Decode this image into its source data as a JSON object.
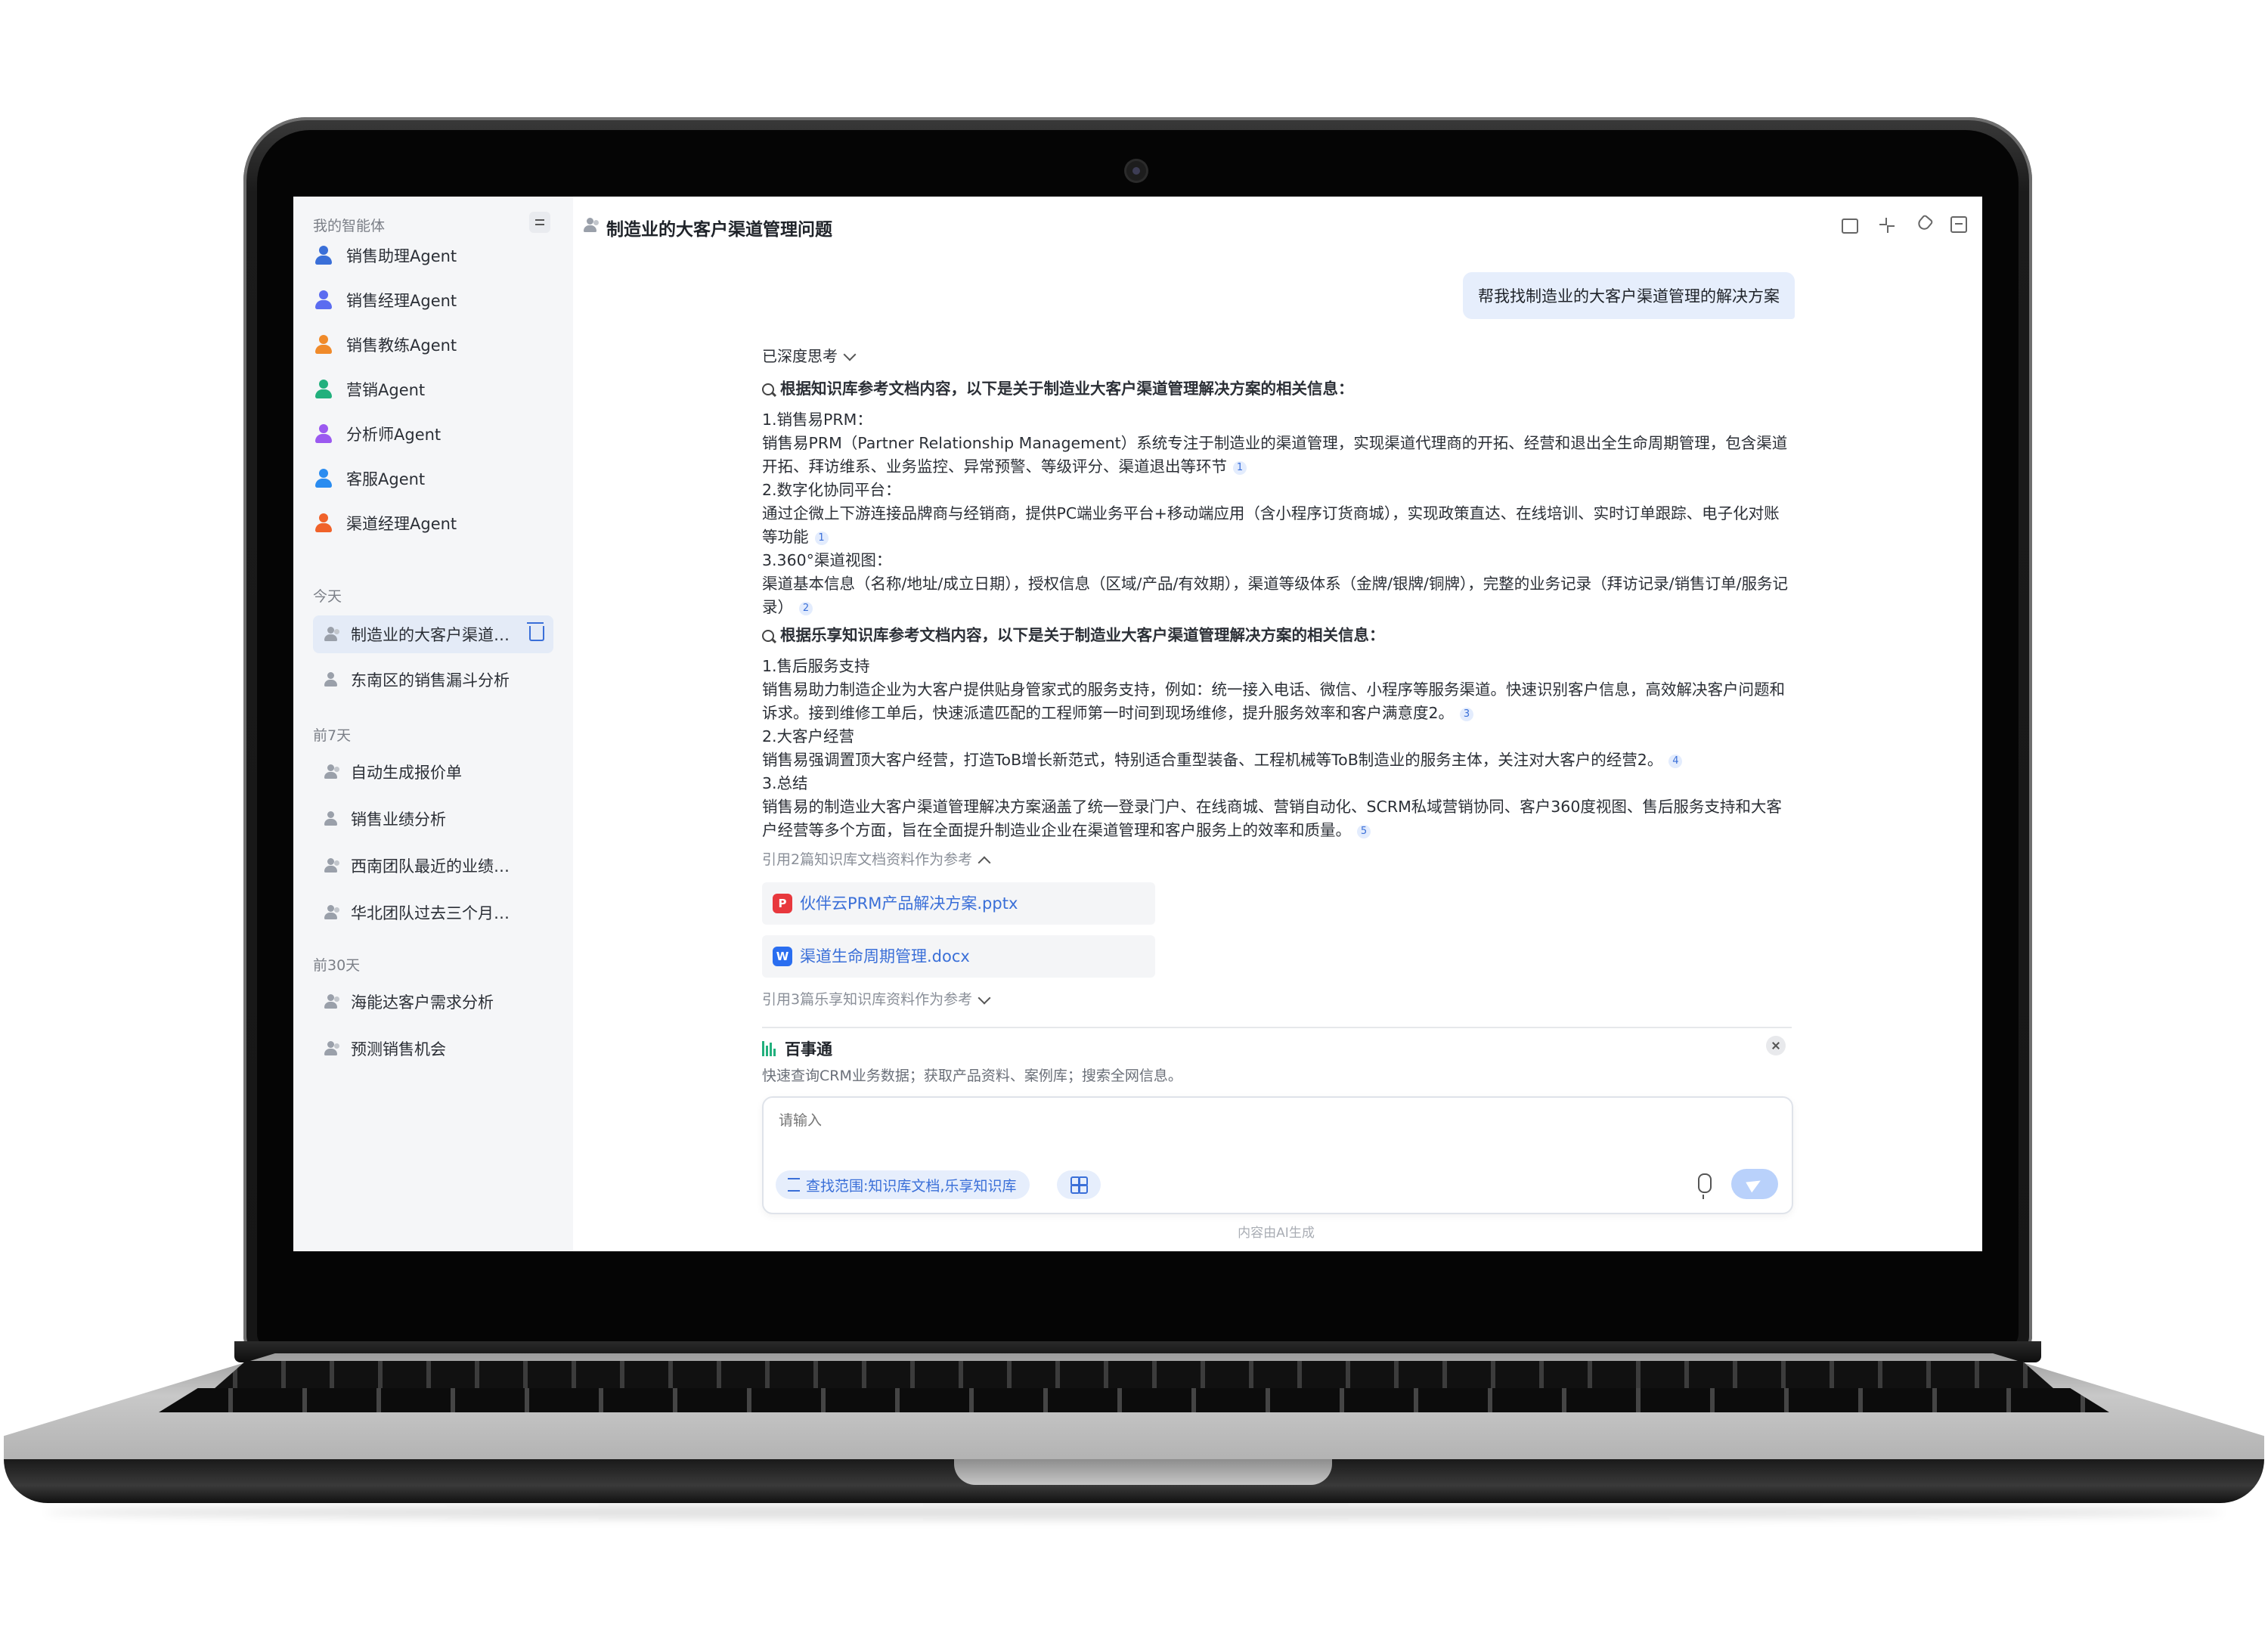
{
  "sidebar": {
    "header": "我的智能体",
    "agents": [
      {
        "label": "销售助理Agent",
        "icon": "person-icon",
        "color": "#3a6fd8"
      },
      {
        "label": "销售经理Agent",
        "icon": "person-icon",
        "color": "#5b6cf0"
      },
      {
        "label": "销售教练Agent",
        "icon": "person-icon",
        "color": "#f08a2a"
      },
      {
        "label": "营销Agent",
        "icon": "chart-icon",
        "color": "#22b07d"
      },
      {
        "label": "分析师Agent",
        "icon": "board-icon",
        "color": "#9b59f0"
      },
      {
        "label": "客服Agent",
        "icon": "headset-icon",
        "color": "#2a8cf0"
      },
      {
        "label": "渠道经理Agent",
        "icon": "refresh-icon",
        "color": "#f0622a"
      }
    ],
    "sections": {
      "today": {
        "label": "今天",
        "items": [
          "制造业的大客户渠道管理问题",
          "东南区的销售漏斗分析"
        ]
      },
      "week": {
        "label": "前7天",
        "items": [
          "自动生成报价单",
          "销售业绩分析",
          "西南团队最近的业绩排行",
          "华北团队过去三个月的客户…"
        ]
      },
      "month": {
        "label": "前30天",
        "items": [
          "海能达客户需求分析",
          "预测销售机会"
        ]
      }
    }
  },
  "main": {
    "title": "制造业的大客户渠道管理问题",
    "user_message": "帮我找制造业的大客户渠道管理的解决方案",
    "thought_label": "已深度思考",
    "heading1": "根据知识库参考文档内容，以下是关于制造业大客户渠道管理解决方案的相关信息：",
    "block1": [
      {
        "title": "1.销售易PRM：",
        "text": "销售易PRM（Partner Relationship Management）系统专注于制造业的渠道管理，实现渠道代理商的开拓、经营和退出全生命周期管理，包含渠道开拓、拜访维系、业务监控、异常预警、等级评分、渠道退出等环节",
        "cite": "1"
      },
      {
        "title": "2.数字化协同平台：",
        "text": "通过企微上下游连接品牌商与经销商，提供PC端业务平台+移动端应用（含小程序订货商城），实现政策直达、在线培训、实时订单跟踪、电子化对账等功能",
        "cite": "1"
      },
      {
        "title": "3.360°渠道视图：",
        "text": "渠道基本信息（名称/地址/成立日期），授权信息（区域/产品/有效期），渠道等级体系（金牌/银牌/铜牌），完整的业务记录（拜访记录/销售订单/服务记录）",
        "cite": "2"
      }
    ],
    "heading2": "根据乐享知识库参考文档内容，以下是关于制造业大客户渠道管理解决方案的相关信息：",
    "block2": [
      {
        "title": "1.售后服务支持",
        "text": "销售易助力制造企业为大客户提供贴身管家式的服务支持，例如：统一接入电话、微信、小程序等服务渠道。快速识别客户信息，高效解决客户问题和诉求。接到维修工单后，快速派遣匹配的工程师第一时间到现场维修，提升服务效率和客户满意度2。",
        "cite": "3"
      },
      {
        "title": "2.大客户经营",
        "text": "销售易强调置顶大客户经营，打造ToB增长新范式，特别适合重型装备、工程机械等ToB制造业的服务主体，关注对大客户的经营2。",
        "cite": "4"
      },
      {
        "title": "3.总结",
        "text": "销售易的制造业大客户渠道管理解决方案涵盖了统一登录门户、在线商城、营销自动化、SCRM私域营销协同、客户360度视图、售后服务支持和大客户经营等多个方面，旨在全面提升制造业企业在渠道管理和客户服务上的效率和质量。",
        "cite": "5"
      }
    ],
    "ref1_label": "引用2篇知识库文档资料作为参考",
    "files": [
      {
        "name": "伙伴云PRM产品解决方案.pptx",
        "badge": "P",
        "color": "#e8383d"
      },
      {
        "name": "渠道生命周期管理.docx",
        "badge": "W",
        "color": "#2a6ef0"
      }
    ],
    "ref2_label": "引用3篇乐享知识库资料作为参考",
    "plugin": {
      "name": "百事通",
      "desc": "快速查询CRM业务数据；获取产品资料、案例库；搜索全网信息。"
    },
    "input": {
      "placeholder": "请输入",
      "scope": "查找范围:知识库文档,乐享知识库"
    },
    "ai_note": "内容由AI生成"
  }
}
